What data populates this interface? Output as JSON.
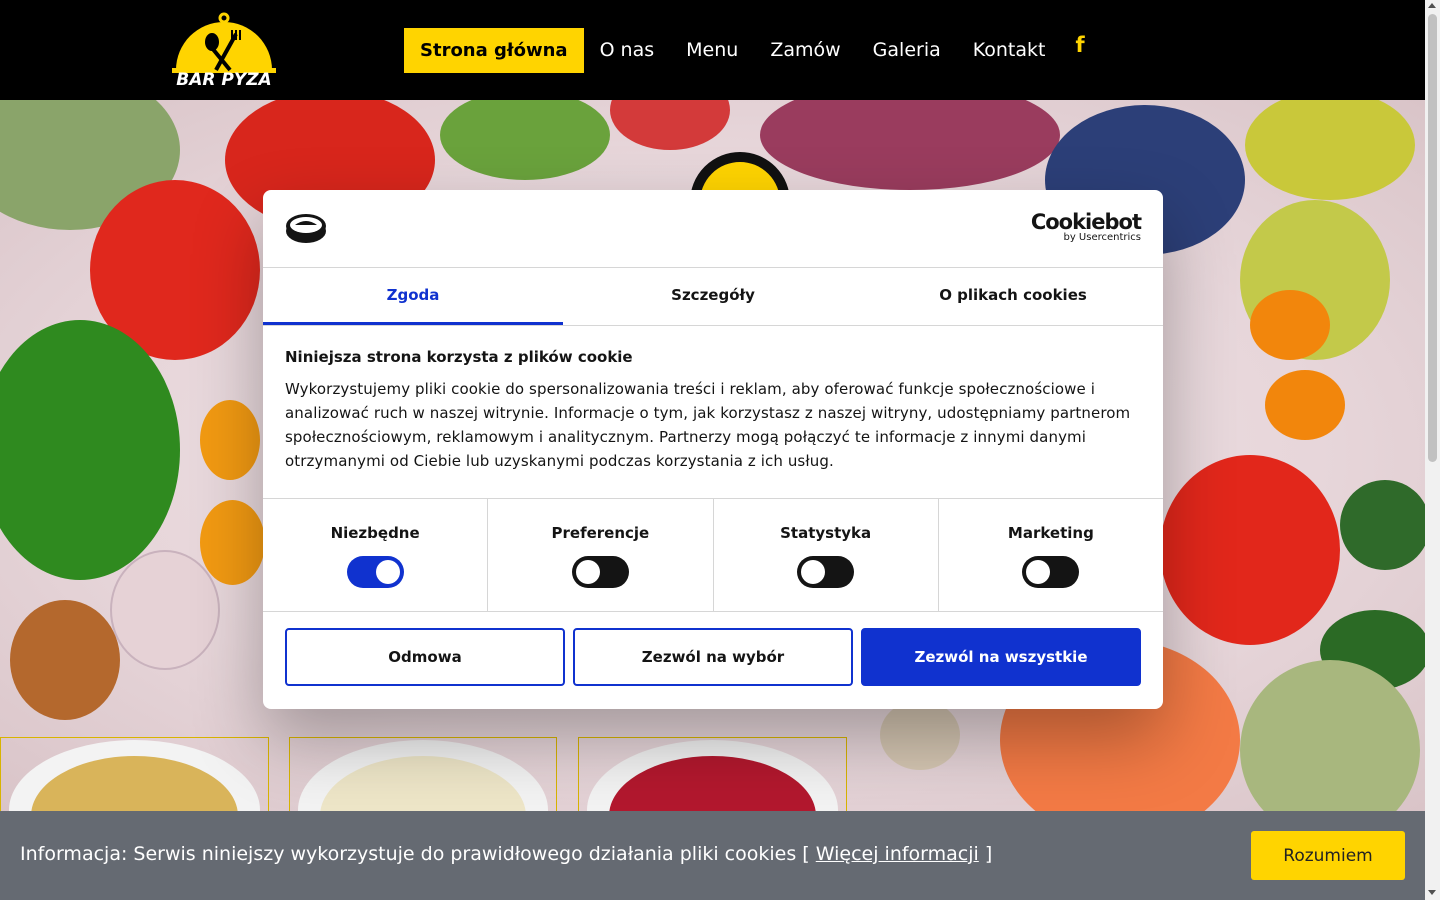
{
  "header": {
    "logo_text": "BAR PYZA",
    "nav": [
      "Strona główna",
      "O nas",
      "Menu",
      "Zamów",
      "Galeria",
      "Kontakt"
    ],
    "facebook_icon": "f"
  },
  "cookie_dialog": {
    "brand": "Cookiebot",
    "brand_sub": "by Usercentrics",
    "tabs": [
      "Zgoda",
      "Szczegóły",
      "O plikach cookies"
    ],
    "heading": "Niniejsza strona korzysta z plików cookie",
    "text": "Wykorzystujemy pliki cookie do spersonalizowania treści i reklam, aby oferować funkcje społecznościowe i analizować ruch w naszej witrynie. Informacje o tym, jak korzystasz z naszej witryny, udostępniamy partnerom społecznościowym, reklamowym i analitycznym. Partnerzy mogą połączyć te informacje z innymi danymi otrzymanymi od Ciebie lub uzyskanymi podczas korzystania z ich usług.",
    "toggles": [
      {
        "label": "Niezbędne",
        "on": true
      },
      {
        "label": "Preferencje",
        "on": false
      },
      {
        "label": "Statystyka",
        "on": false
      },
      {
        "label": "Marketing",
        "on": false
      }
    ],
    "buttons": [
      "Odmowa",
      "Zezwól na wybór",
      "Zezwól na wszystkie"
    ]
  },
  "infobar": {
    "text_before": "Informacja: Serwis niniejszy wykorzystuje do prawidłowego działania pliki cookies [ ",
    "link": "Więcej informacji",
    "text_after": " ]",
    "button": "Rozumiem"
  },
  "colors": {
    "accent_yellow": "#ffd400",
    "cookiebot_blue": "#1032cf",
    "infobar_gray": "#656a72"
  }
}
